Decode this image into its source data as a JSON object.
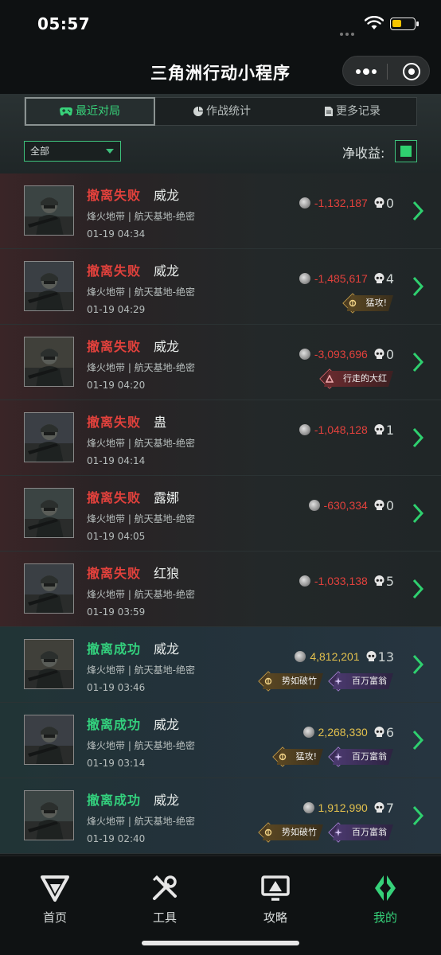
{
  "status_bar": {
    "time": "05:57"
  },
  "nav": {
    "title": "三角洲行动小程序"
  },
  "tabs": [
    {
      "label": "最近对局",
      "icon": "gamepad-icon",
      "active": true
    },
    {
      "label": "作战统计",
      "icon": "pie-chart-icon",
      "active": false
    },
    {
      "label": "更多记录",
      "icon": "document-icon",
      "active": false
    }
  ],
  "filter": {
    "selected": "全部"
  },
  "net_income": {
    "label": "净收益:",
    "enabled": true
  },
  "records": [
    {
      "result": "撤离失败",
      "status": "fail",
      "operator": "威龙",
      "map": "烽火地带 | 航天基地-绝密",
      "time": "01-19 04:34",
      "value": "-1,132,187",
      "kills": "0",
      "badges": []
    },
    {
      "result": "撤离失败",
      "status": "fail",
      "operator": "威龙",
      "map": "烽火地带 | 航天基地-绝密",
      "time": "01-19 04:29",
      "value": "-1,485,617",
      "kills": "4",
      "badges": [
        {
          "label": "猛攻!",
          "style": "gold"
        }
      ]
    },
    {
      "result": "撤离失败",
      "status": "fail",
      "operator": "威龙",
      "map": "烽火地带 | 航天基地-绝密",
      "time": "01-19 04:20",
      "value": "-3,093,696",
      "kills": "0",
      "badges": [
        {
          "label": "行走的大红",
          "style": "red"
        }
      ]
    },
    {
      "result": "撤离失败",
      "status": "fail",
      "operator": "蛊",
      "map": "烽火地带 | 航天基地-绝密",
      "time": "01-19 04:14",
      "value": "-1,048,128",
      "kills": "1",
      "badges": []
    },
    {
      "result": "撤离失败",
      "status": "fail",
      "operator": "露娜",
      "map": "烽火地带 | 航天基地-绝密",
      "time": "01-19 04:05",
      "value": "-630,334",
      "kills": "0",
      "badges": []
    },
    {
      "result": "撤离失败",
      "status": "fail",
      "operator": "红狼",
      "map": "烽火地带 | 航天基地-绝密",
      "time": "01-19 03:59",
      "value": "-1,033,138",
      "kills": "5",
      "badges": []
    },
    {
      "result": "撤离成功",
      "status": "success",
      "operator": "威龙",
      "map": "烽火地带 | 航天基地-绝密",
      "time": "01-19 03:46",
      "value": "4,812,201",
      "kills": "13",
      "badges": [
        {
          "label": "势如破竹",
          "style": "gold"
        },
        {
          "label": "百万富翁",
          "style": "purple"
        }
      ]
    },
    {
      "result": "撤离成功",
      "status": "success",
      "operator": "威龙",
      "map": "烽火地带 | 航天基地-绝密",
      "time": "01-19 03:14",
      "value": "2,268,330",
      "kills": "6",
      "badges": [
        {
          "label": "猛攻!",
          "style": "gold"
        },
        {
          "label": "百万富翁",
          "style": "purple"
        }
      ]
    },
    {
      "result": "撤离成功",
      "status": "success",
      "operator": "威龙",
      "map": "烽火地带 | 航天基地-绝密",
      "time": "01-19 02:40",
      "value": "1,912,990",
      "kills": "7",
      "badges": [
        {
          "label": "势如破竹",
          "style": "gold"
        },
        {
          "label": "百万富翁",
          "style": "purple"
        }
      ]
    }
  ],
  "bottom_nav": [
    {
      "label": "首页",
      "icon": "home-logo-icon",
      "active": false
    },
    {
      "label": "工具",
      "icon": "tools-icon",
      "active": false
    },
    {
      "label": "攻略",
      "icon": "guide-monitor-icon",
      "active": false
    },
    {
      "label": "我的",
      "icon": "profile-logo-icon",
      "active": true
    }
  ],
  "colors": {
    "accent": "#36d27a",
    "fail": "#e2413c",
    "success": "#33d07d",
    "gold_value": "#e2c04d"
  }
}
